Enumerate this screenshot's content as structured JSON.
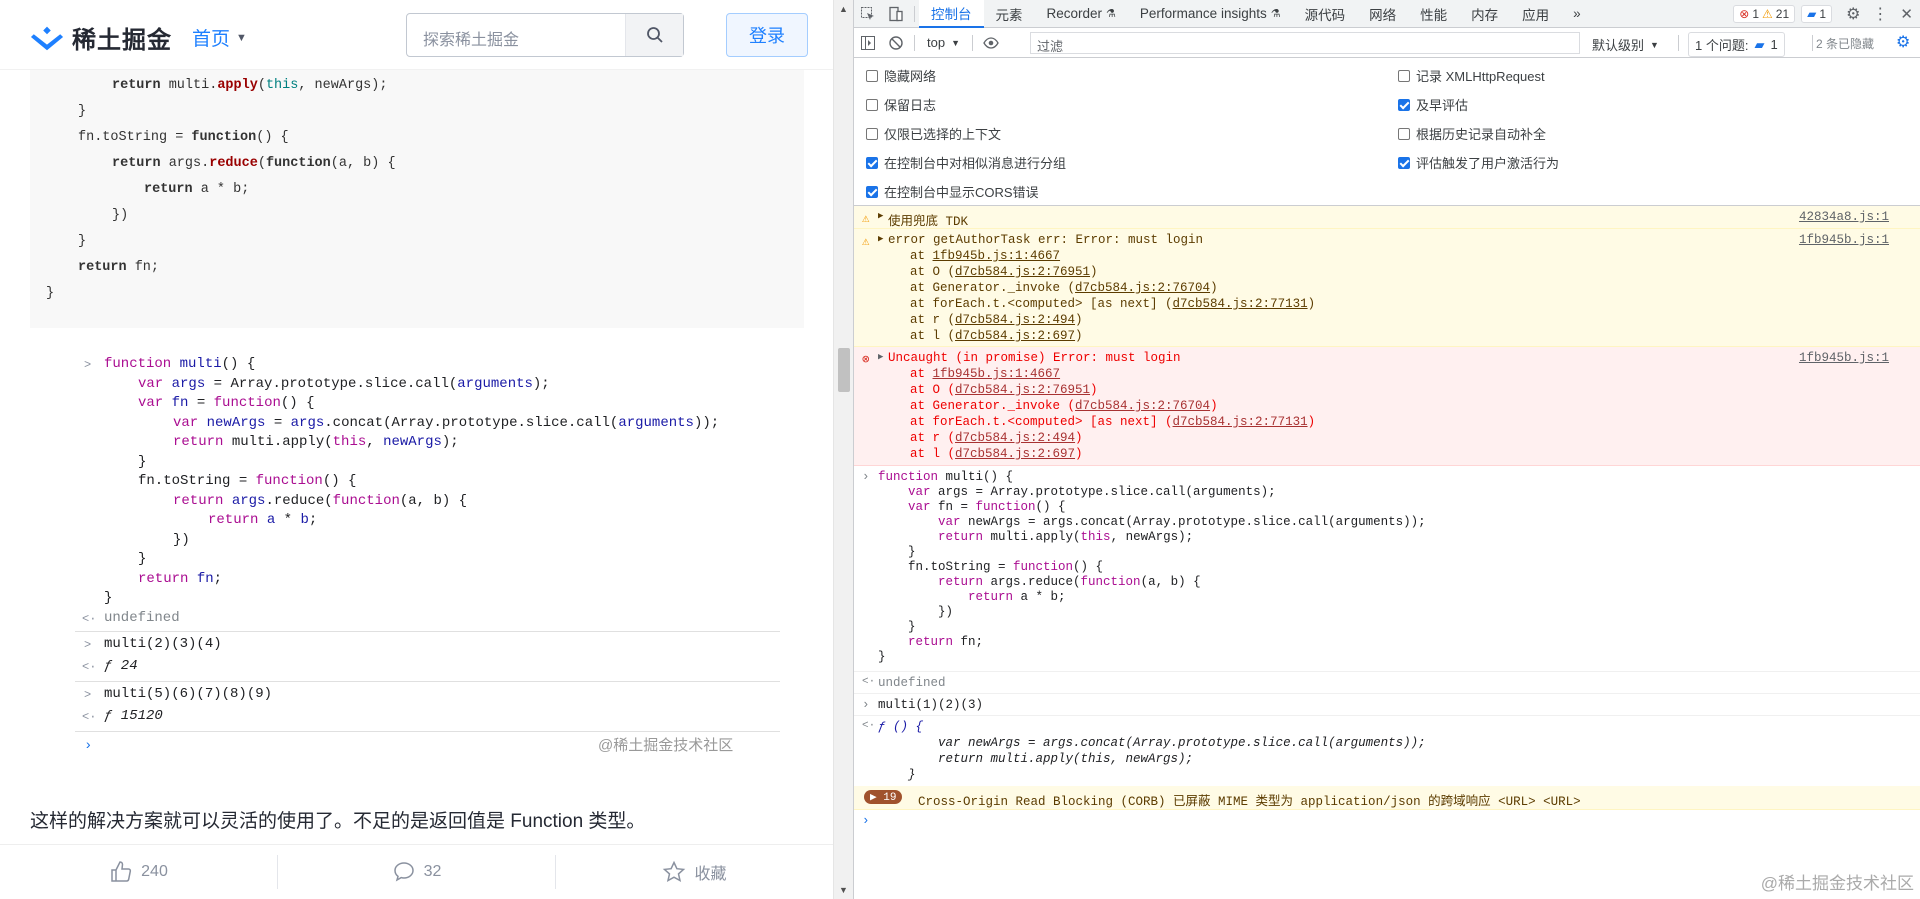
{
  "left": {
    "logo": "稀土掘金",
    "nav": "首页",
    "search_placeholder": "探索稀土掘金",
    "login": "登录",
    "code_block": [
      "        return multi.apply(this, newArgs);",
      "    }",
      "    fn.toString = function() {",
      "        return args.reduce(function(a, b) {",
      "            return a * b;",
      "        })",
      "    }",
      "    return fn;",
      "}"
    ],
    "shot": {
      "lines": [
        "function multi() {",
        "    var args = Array.prototype.slice.call(arguments);",
        "    var fn = function() {",
        "        var newArgs = args.concat(Array.prototype.slice.call(arguments));",
        "        return multi.apply(this, newArgs);",
        "    }",
        "    fn.toString = function() {",
        "        return args.reduce(function(a, b) {",
        "            return a * b;",
        "        })",
        "    }",
        "    return fn;",
        "}"
      ],
      "undefined": "undefined",
      "cmd1": "multi(2)(3)(4)",
      "res1": "ƒ 24",
      "cmd2": "multi(5)(6)(7)(8)(9)",
      "res2": "ƒ 15120",
      "watermark": "@稀土掘金技术社区"
    },
    "paragraph": "这样的解决方案就可以灵活的使用了。不足的是返回值是 Function 类型。",
    "actions": {
      "like": "240",
      "comment": "32",
      "collect": "收藏"
    }
  },
  "devtools": {
    "tabs": [
      "控制台",
      "元素",
      "Recorder",
      "Performance insights",
      "源代码",
      "网络",
      "性能",
      "内存",
      "应用"
    ],
    "badges": {
      "errors": "1",
      "warnings": "21",
      "messages": "1"
    },
    "toolbar": {
      "context": "top",
      "filter_placeholder": "过滤",
      "level": "默认级别",
      "issues_label": "1 个问题:",
      "issues_count": "1",
      "hidden": "2 条已隐藏"
    },
    "settings": {
      "left": [
        "隐藏网络",
        "保留日志",
        "仅限已选择的上下文",
        "在控制台中对相似消息进行分组",
        "在控制台中显示CORS错误"
      ],
      "right": [
        "记录 XMLHttpRequest",
        "及早评估",
        "根据历史记录自动补全",
        "评估触发了用户激活行为"
      ]
    },
    "console": {
      "warn1": {
        "text": "使用兜底 TDK",
        "src": "42834a8.js:1"
      },
      "warn2": {
        "text": "error getAuthorTask err: Error: must login",
        "src": "1fb945b.js:1",
        "stack": [
          [
            "at ",
            "1fb945b.js:1:4667",
            ""
          ],
          [
            "at O (",
            "d7cb584.js:2:76951",
            ")"
          ],
          [
            "at Generator._invoke (",
            "d7cb584.js:2:76704",
            ")"
          ],
          [
            "at forEach.t.<computed> [as next] (",
            "d7cb584.js:2:77131",
            ")"
          ],
          [
            "at r (",
            "d7cb584.js:2:494",
            ")"
          ],
          [
            "at l (",
            "d7cb584.js:2:697",
            ")"
          ]
        ]
      },
      "err1": {
        "text": "Uncaught (in promise) Error: must login",
        "src": "1fb945b.js:1"
      },
      "code": [
        "function multi() {",
        "    var args = Array.prototype.slice.call(arguments);",
        "    var fn = function() {",
        "        var newArgs = args.concat(Array.prototype.slice.call(arguments));",
        "        return multi.apply(this, newArgs);",
        "    }",
        "    fn.toString = function() {",
        "        return args.reduce(function(a, b) {",
        "            return a * b;",
        "        })",
        "    }",
        "    return fn;",
        "}"
      ],
      "undefined": "undefined",
      "cmd": "multi(1)(2)(3)",
      "result": [
        "ƒ () {",
        "        var newArgs = args.concat(Array.prototype.slice.call(arguments));",
        "        return multi.apply(this, newArgs);",
        "    }"
      ],
      "corb": {
        "count": "19",
        "text": "Cross-Origin Read Blocking (CORB) 已屏蔽 MIME 类型为 application/json 的跨域响应 <URL> <URL>"
      }
    },
    "watermark": "@稀土掘金技术社区"
  }
}
